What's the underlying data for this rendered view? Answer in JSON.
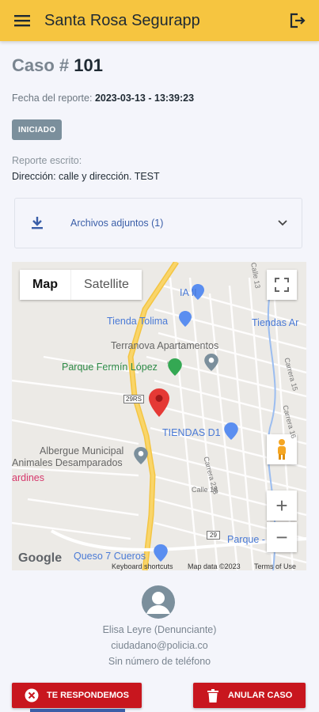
{
  "app": {
    "title": "Santa Rosa Segurapp"
  },
  "case": {
    "prefix": "Caso #",
    "number": "101",
    "date_label": "Fecha del reporte:",
    "date_value": "2023-03-13 - 13:39:23",
    "status": "INICIADO",
    "written_label": "Reporte escrito:",
    "written_text": "Dirección: calle y dirección. TEST"
  },
  "attachments": {
    "label": "Archivos adjuntos (1)"
  },
  "map": {
    "type_map": "Map",
    "type_satellite": "Satellite",
    "labels": {
      "a_ii": "IA II",
      "tienda_tolima": "Tienda Tolima",
      "tiendas_ar": "Tiendas Ar",
      "terranova": "Terranova Apartamentos",
      "parque_fermin": "Parque Fermín López",
      "tiendas_d1": "TIENDAS D1",
      "albergue1": "Albergue Municipal",
      "albergue2": "Animales Desamparados",
      "jardines": "ardines",
      "queso": "Queso 7 Cueros",
      "parque": "Parque -",
      "calle18": "Calle 18",
      "carrera23b": "Carrera 23B",
      "carrera15": "Carrera 15",
      "carrera16": "Carrera 16",
      "calle13": "Calle 13",
      "road_29": "29",
      "road_29rs": "29RS"
    },
    "footer": {
      "google": "Google",
      "shortcuts": "Keyboard shortcuts",
      "mapdata": "Map data ©2023",
      "terms": "Terms of Use"
    }
  },
  "reporter": {
    "name": "Elisa Leyre (Denunciante)",
    "email": "ciudadano@policia.co",
    "phone": "Sin número de teléfono"
  },
  "actions": {
    "respond": "TE RESPONDEMOS",
    "cancel": "ANULAR CASO"
  },
  "colors": {
    "appbar": "#f6c540",
    "action": "#c8161e",
    "status": "#7b8f9c",
    "link": "#3a5ea8"
  }
}
